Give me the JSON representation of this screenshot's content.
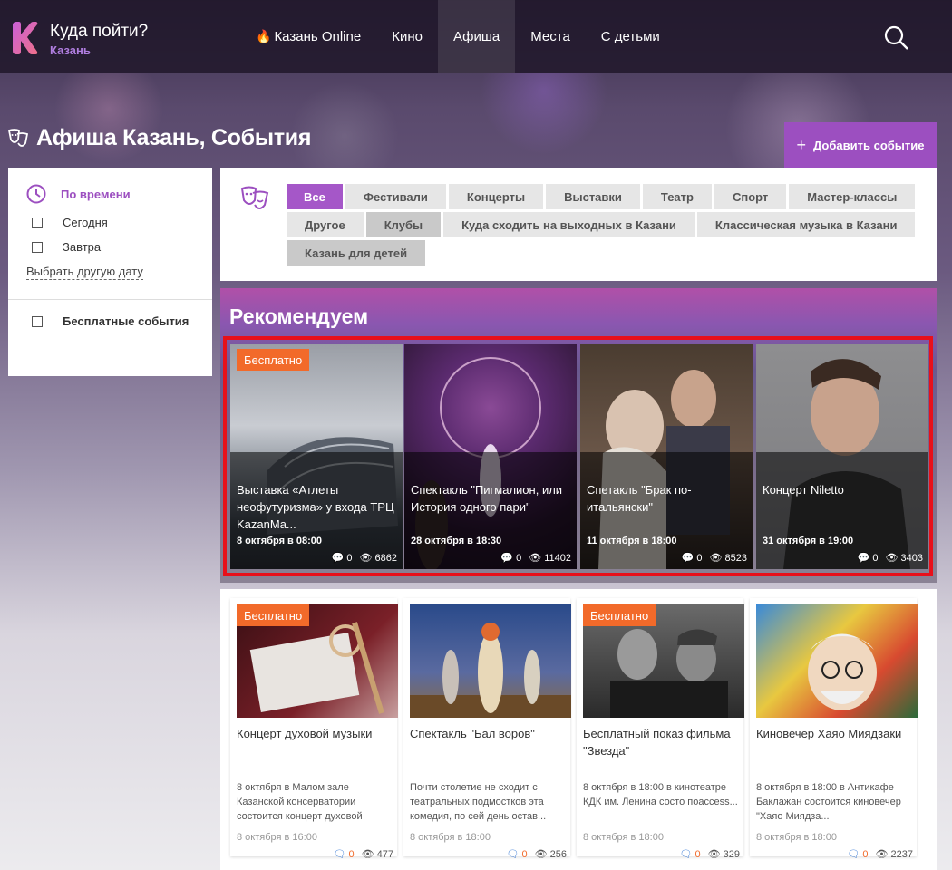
{
  "header": {
    "brand_title": "Куда пойти?",
    "brand_city": "Казань",
    "nav": [
      {
        "label": "Казань Online",
        "icon": "fire-icon"
      },
      {
        "label": "Кино"
      },
      {
        "label": "Афиша",
        "active": true
      },
      {
        "label": "Места"
      },
      {
        "label": "С детьми"
      }
    ]
  },
  "page": {
    "title": "Афиша Казань, События",
    "add_button": "Добавить событие"
  },
  "sidebar": {
    "time_label": "По времени",
    "today": "Сегодня",
    "tomorrow": "Завтра",
    "other_date": "Выбрать другую дату",
    "free": "Бесплатные события"
  },
  "filter": {
    "tags": [
      "Все",
      "Фестивали",
      "Концерты",
      "Выставки",
      "Театр",
      "Спорт",
      "Мастер-классы",
      "Другое",
      "Клубы",
      "Куда сходить на выходных в Казани",
      "Классическая музыка в Казани",
      "Казань для детей"
    ],
    "active": "Все"
  },
  "recommended": {
    "title": "Рекомендуем",
    "cards": [
      {
        "badge": "Бесплатно",
        "title": "Выставка «Атлеты неофутуризма» у входа ТРЦ KazanMa...",
        "date": "8 октября в 08:00",
        "comments": "0",
        "views": "6862"
      },
      {
        "badge": "",
        "title": "Спектакль \"Пигмалион, или История одного пари\"",
        "date": "28 октября в 18:30",
        "comments": "0",
        "views": "11402"
      },
      {
        "badge": "",
        "title": "Спетакль \"Брак по-итальянски\"",
        "date": "11 октября в 18:00",
        "comments": "0",
        "views": "8523"
      },
      {
        "badge": "",
        "title": "Концерт Niletto",
        "date": "31 октября в 19:00",
        "comments": "0",
        "views": "3403"
      }
    ]
  },
  "events": [
    {
      "badge": "Бесплатно",
      "title": "Концерт духовой музыки",
      "desc": "8 октября в Малом зале Казанской консерватории состоится концерт духовой",
      "date": "8 октября в 16:00",
      "comments": "0",
      "views": "477"
    },
    {
      "badge": "",
      "title": "Спектакль \"Бал воров\"",
      "desc": "Почти столетие не сходит с театральных подмостков эта комедия, по сей день остав...",
      "date": "8 октября в 18:00",
      "comments": "0",
      "views": "256"
    },
    {
      "badge": "Бесплатно",
      "title": "Бесплатный показ фильма \"Звезда\"",
      "desc": "8 октября в 18:00 в кинотеатре КДК им. Ленина состо поaccess...",
      "date": "8 октября в 18:00",
      "comments": "0",
      "views": "329"
    },
    {
      "badge": "",
      "title": "Киновечер Хаяо Миядзаки",
      "desc": "8 октября в 18:00 в Антикафе Баклажан состоится киновечер \"Хаяо Миядза...",
      "date": "8 октября в 18:00",
      "comments": "0",
      "views": "2237"
    }
  ],
  "colors": {
    "accent": "#9c4fc0",
    "badge": "#f26a2a",
    "highlight_frame": "#e8101a"
  }
}
